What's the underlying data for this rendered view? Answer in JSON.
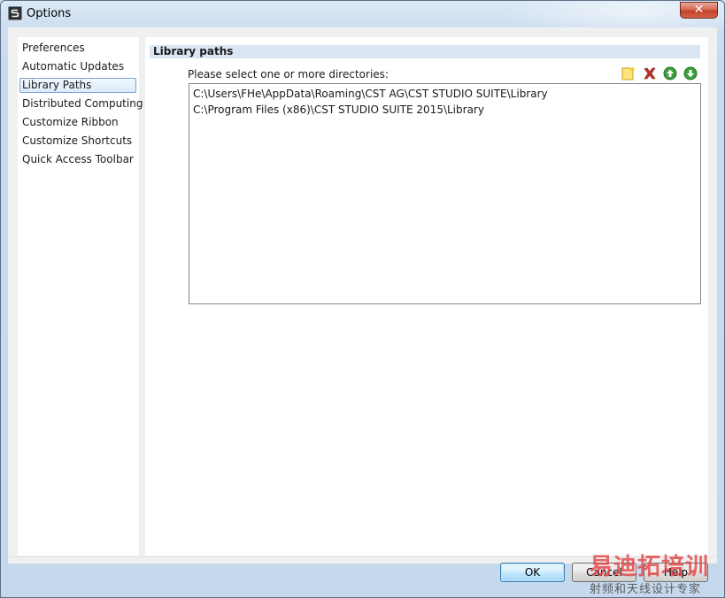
{
  "window": {
    "title": "Options",
    "close_label": "✕"
  },
  "sidebar": {
    "items": [
      {
        "label": "Preferences",
        "selected": false
      },
      {
        "label": "Automatic Updates",
        "selected": false
      },
      {
        "label": "Library Paths",
        "selected": true
      },
      {
        "label": "Distributed Computing",
        "selected": false
      },
      {
        "label": "Customize Ribbon",
        "selected": false
      },
      {
        "label": "Customize Shortcuts",
        "selected": false
      },
      {
        "label": "Quick Access Toolbar",
        "selected": false
      }
    ]
  },
  "library_paths": {
    "section_title": "Library paths",
    "instruction": "Please select one or more directories:",
    "toolbar_icons": [
      "new-folder-icon",
      "delete-icon",
      "move-up-icon",
      "move-down-icon"
    ],
    "paths": [
      "C:\\Users\\FHe\\AppData\\Roaming\\CST AG\\CST STUDIO SUITE\\Library",
      "C:\\Program Files (x86)\\CST STUDIO SUITE 2015\\Library"
    ]
  },
  "footer": {
    "ok_label": "OK",
    "cancel_label": "Cancel",
    "help_label": "Help"
  },
  "watermark": {
    "main": "易迪拓培训",
    "sub": "射频和天线设计专家"
  },
  "colors": {
    "header_band": "#dbe6f4",
    "selection_border": "#7da2ce",
    "close_red": "#c2412a",
    "arrow_green": "#3aa03a",
    "delete_red": "#c0302a"
  }
}
